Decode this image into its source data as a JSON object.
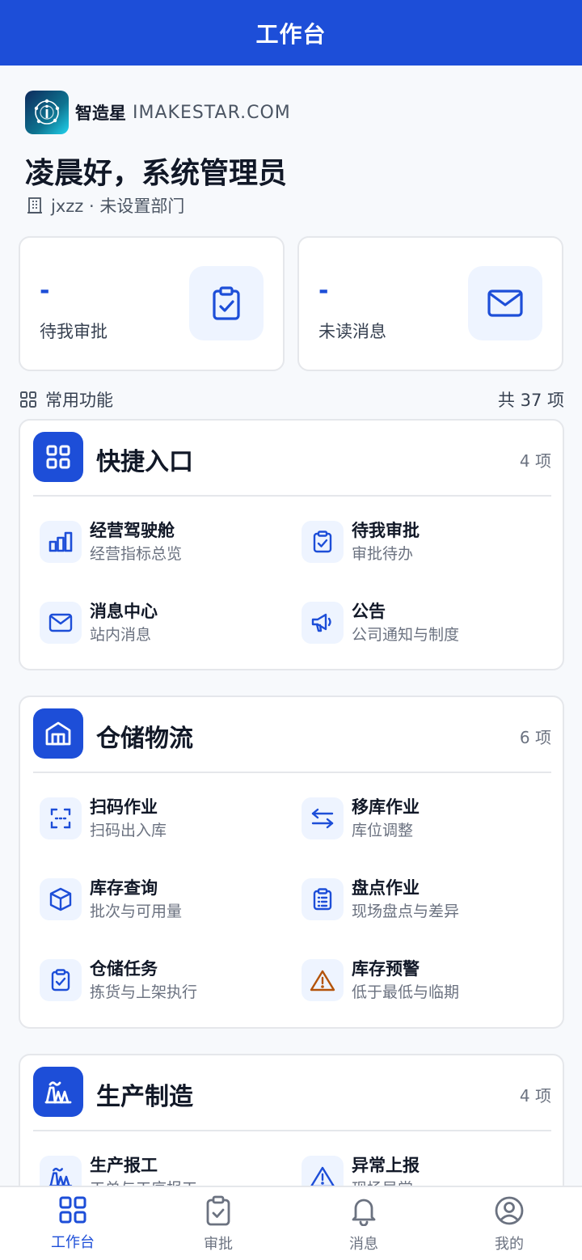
{
  "header": {
    "title": "工作台"
  },
  "brand": {
    "name": "智造星",
    "domain": "IMAKESTAR.COM"
  },
  "greeting": "凌晨好，系统管理员",
  "org": "jxzz · 未设置部门",
  "stats": [
    {
      "value": "-",
      "label": "待我审批",
      "icon": "clipboard-check-icon"
    },
    {
      "value": "-",
      "label": "未读消息",
      "icon": "mail-icon"
    }
  ],
  "section": {
    "title": "常用功能",
    "total": "共 37 项"
  },
  "groups": [
    {
      "title": "快捷入口",
      "count": "4 项",
      "icon": "grid-icon",
      "items": [
        {
          "title": "经营驾驶舱",
          "sub": "经营指标总览",
          "icon": "bar-chart-icon"
        },
        {
          "title": "待我审批",
          "sub": "审批待办",
          "icon": "clipboard-check-icon"
        },
        {
          "title": "消息中心",
          "sub": "站内消息",
          "icon": "mail-icon"
        },
        {
          "title": "公告",
          "sub": "公司通知与制度",
          "icon": "megaphone-icon"
        }
      ]
    },
    {
      "title": "仓储物流",
      "count": "6 项",
      "icon": "warehouse-icon",
      "items": [
        {
          "title": "扫码作业",
          "sub": "扫码出入库",
          "icon": "scan-icon"
        },
        {
          "title": "移库作业",
          "sub": "库位调整",
          "icon": "transfer-icon"
        },
        {
          "title": "库存查询",
          "sub": "批次与可用量",
          "icon": "box-icon"
        },
        {
          "title": "盘点作业",
          "sub": "现场盘点与差异",
          "icon": "clipboard-list-icon"
        },
        {
          "title": "仓储任务",
          "sub": "拣货与上架执行",
          "icon": "clipboard-check-icon"
        },
        {
          "title": "库存预警",
          "sub": "低于最低与临期",
          "icon": "warning-icon",
          "accent": "#b45309"
        }
      ]
    },
    {
      "title": "生产制造",
      "count": "4 项",
      "icon": "factory-icon",
      "items": [
        {
          "title": "生产报工",
          "sub": "工单与工序报工",
          "icon": "factory-icon"
        },
        {
          "title": "异常上报",
          "sub": "现场异常",
          "icon": "warning-icon"
        }
      ]
    }
  ],
  "nav": [
    {
      "label": "工作台",
      "icon": "grid-icon",
      "active": true
    },
    {
      "label": "审批",
      "icon": "clipboard-check-icon"
    },
    {
      "label": "消息",
      "icon": "bell-icon"
    },
    {
      "label": "我的",
      "icon": "user-circle-icon"
    }
  ],
  "colors": {
    "primary": "#1d4ed8",
    "iconBg": "#eef4ff",
    "warning": "#b45309"
  }
}
